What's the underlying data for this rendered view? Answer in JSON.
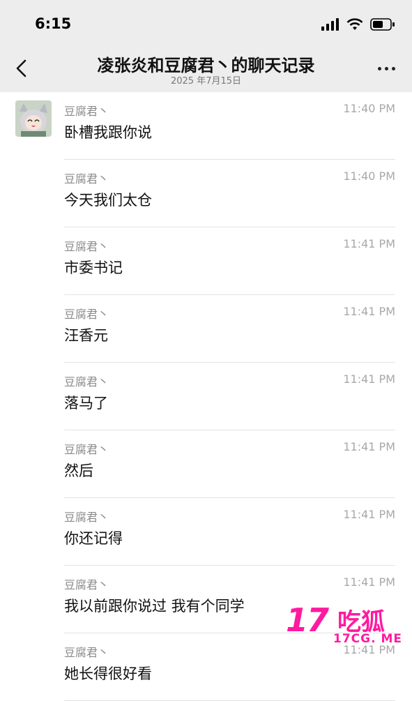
{
  "status_bar": {
    "time": "6:15",
    "icons": [
      "signal-icon",
      "wifi-icon",
      "battery-icon"
    ]
  },
  "header": {
    "title": "凌张炎和豆腐君丶的聊天记录",
    "subtitle": "2025 年7月15日",
    "back_icon": "chevron-left-icon",
    "more_icon": "more-icon"
  },
  "messages": [
    {
      "sender": "豆腐君丶",
      "time": "11:40 PM",
      "text": "卧槽我跟你说",
      "has_avatar": true
    },
    {
      "sender": "豆腐君丶",
      "time": "11:40 PM",
      "text": "今天我们太仓"
    },
    {
      "sender": "豆腐君丶",
      "time": "11:41 PM",
      "text": "市委书记"
    },
    {
      "sender": "豆腐君丶",
      "time": "11:41 PM",
      "text": "汪香元"
    },
    {
      "sender": "豆腐君丶",
      "time": "11:41 PM",
      "text": "落马了"
    },
    {
      "sender": "豆腐君丶",
      "time": "11:41 PM",
      "text": "然后"
    },
    {
      "sender": "豆腐君丶",
      "time": "11:41 PM",
      "text": "你还记得"
    },
    {
      "sender": "豆腐君丶",
      "time": "11:41 PM",
      "text": "我以前跟你说过 我有个同学"
    },
    {
      "sender": "豆腐君丶",
      "time": "11:41 PM",
      "text": "她长得很好看"
    }
  ],
  "watermark": {
    "number": "17",
    "chars": "吃狐",
    "url": "17CG. ME"
  },
  "colors": {
    "header_bg": "#ededed",
    "watermark": "#ff1aa0"
  }
}
